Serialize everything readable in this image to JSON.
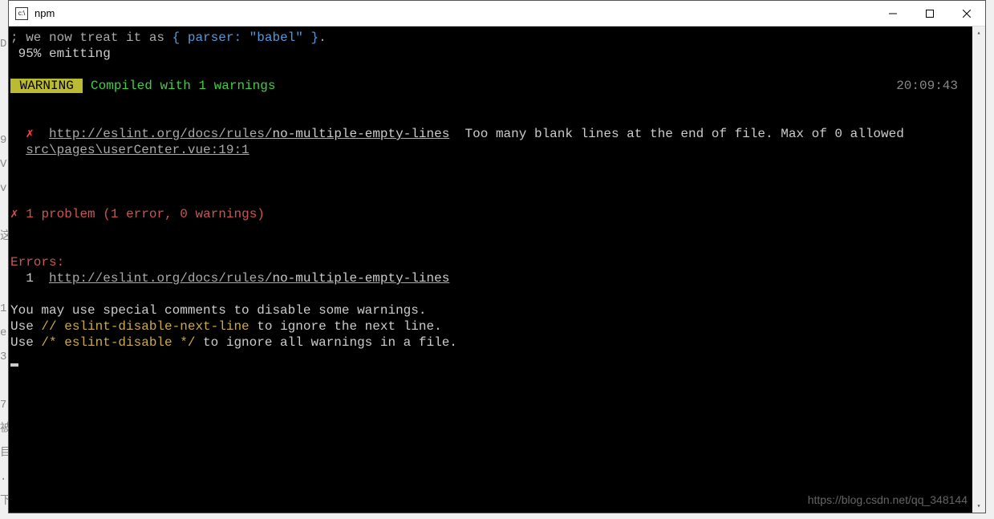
{
  "window": {
    "title": "npm",
    "icon_text": "c:\\"
  },
  "terminal": {
    "line1_prefix": "; we now treat it as ",
    "line1_json": "{ parser: \"babel\" }",
    "line1_suffix": ".",
    "line2": " 95% emitting",
    "warning_label": " WARNING ",
    "compiled_with": " Compiled with 1 warnings",
    "timestamp": "20:09:43",
    "error_x": "✗",
    "eslint_url_base": "http://eslint.org/docs/rules/",
    "rule_name": "no-multiple-empty-lines",
    "error_msg": "  Too many blank lines at the end of file. Max of 0 allowed",
    "file_location": "src\\pages\\userCenter.vue:19:1",
    "problem_summary": " 1 problem (1 error, 0 warnings)",
    "errors_label": "Errors:",
    "error_count": "  1  ",
    "hint1": "You may use special comments to disable some warnings.",
    "hint2_prefix": "Use ",
    "hint2_code": "// eslint-disable-next-line",
    "hint2_suffix": " to ignore the next line.",
    "hint3_prefix": "Use ",
    "hint3_code": "/* eslint-disable */",
    "hint3_suffix": " to ignore all warnings in a file."
  },
  "watermark": "https://blog.csdn.net/qq_348144"
}
